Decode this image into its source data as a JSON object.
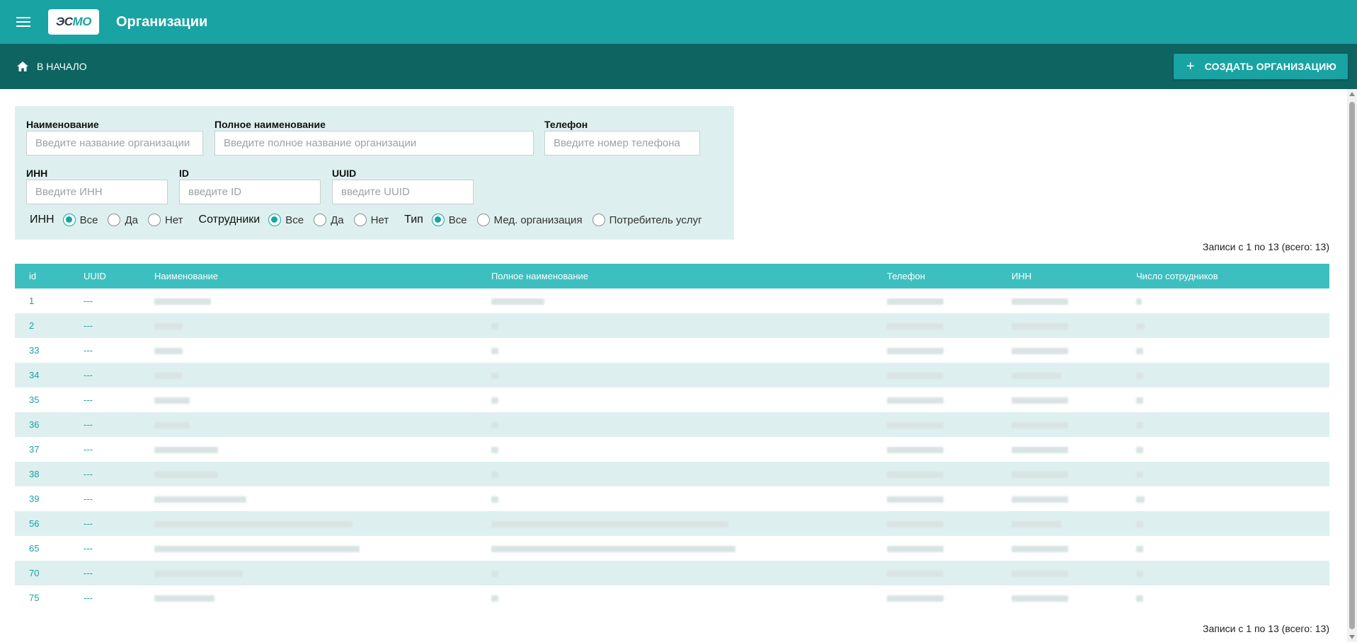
{
  "app": {
    "title": "Организации",
    "logo_text_a": "ЭС",
    "logo_text_b": "МО"
  },
  "subbar": {
    "home_label": "В НАЧАЛО",
    "create_label": "СОЗДАТЬ ОРГАНИЗАЦИЮ"
  },
  "filters": {
    "name": {
      "label": "Наименование",
      "placeholder": "Введите название организации"
    },
    "full_name": {
      "label": "Полное наименование",
      "placeholder": "Введите полное название организации"
    },
    "phone": {
      "label": "Телефон",
      "placeholder": "Введите номер телефона"
    },
    "inn": {
      "label": "ИНН",
      "placeholder": "Введите ИНН"
    },
    "id": {
      "label": "ID",
      "placeholder": "введите ID"
    },
    "uuid": {
      "label": "UUID",
      "placeholder": "введите UUID"
    },
    "radio_inn": {
      "label": "ИНН",
      "options": [
        "Все",
        "Да",
        "Нет"
      ],
      "selected": "Все"
    },
    "radio_staff": {
      "label": "Сотрудники",
      "options": [
        "Все",
        "Да",
        "Нет"
      ],
      "selected": "Все"
    },
    "radio_type": {
      "label": "Тип",
      "options": [
        "Все",
        "Мед. организация",
        "Потребитель услуг"
      ],
      "selected": "Все"
    }
  },
  "records_info": "Записи с 1 по 13 (всего: 13)",
  "table": {
    "columns": [
      "id",
      "UUID",
      "Наименование",
      "Полное наименование",
      "Телефон",
      "ИНН",
      "Число сотрудников"
    ],
    "rows": [
      {
        "id": "1",
        "uuid": "---"
      },
      {
        "id": "2",
        "uuid": "---"
      },
      {
        "id": "33",
        "uuid": "---"
      },
      {
        "id": "34",
        "uuid": "---"
      },
      {
        "id": "35",
        "uuid": "---"
      },
      {
        "id": "36",
        "uuid": "---"
      },
      {
        "id": "37",
        "uuid": "---"
      },
      {
        "id": "38",
        "uuid": "---"
      },
      {
        "id": "39",
        "uuid": "---"
      },
      {
        "id": "56",
        "uuid": "---"
      },
      {
        "id": "65",
        "uuid": "---"
      },
      {
        "id": "70",
        "uuid": "---"
      },
      {
        "id": "75",
        "uuid": "---"
      }
    ]
  },
  "colors": {
    "topbar": "#19a3a3",
    "subbar": "#0e6461",
    "table_header": "#3ebfbf",
    "panel": "#ddf0ef",
    "accent": "#19a3a3"
  },
  "icons": [
    "menu-icon",
    "home-icon",
    "plus-icon"
  ]
}
